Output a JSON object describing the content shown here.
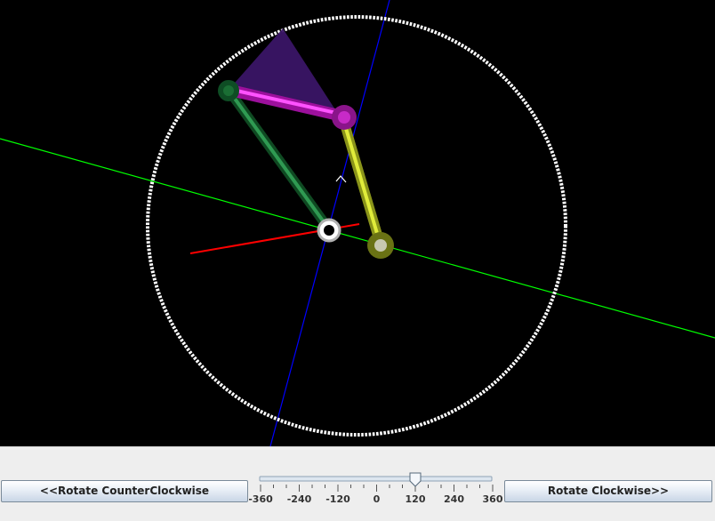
{
  "viewport": {
    "background": "#000000",
    "colors": {
      "y_axis": "#0000ff",
      "x_axis": "#00ff00",
      "z_axis": "#ff0000",
      "circle": "#ffffff",
      "link_green": "#1f7a3a",
      "link_magenta": "#d61cd6",
      "link_yellow": "#b8c41e",
      "sector": "#3a1566"
    }
  },
  "controls": {
    "rotate_ccw_label": "<<Rotate CounterClockwise",
    "rotate_cw_label": "Rotate Clockwise>>",
    "slider": {
      "min": -360,
      "max": 360,
      "value": 120,
      "tick_labels": [
        "-360",
        "-240",
        "-120",
        "0",
        "120",
        "240",
        "360"
      ]
    }
  }
}
